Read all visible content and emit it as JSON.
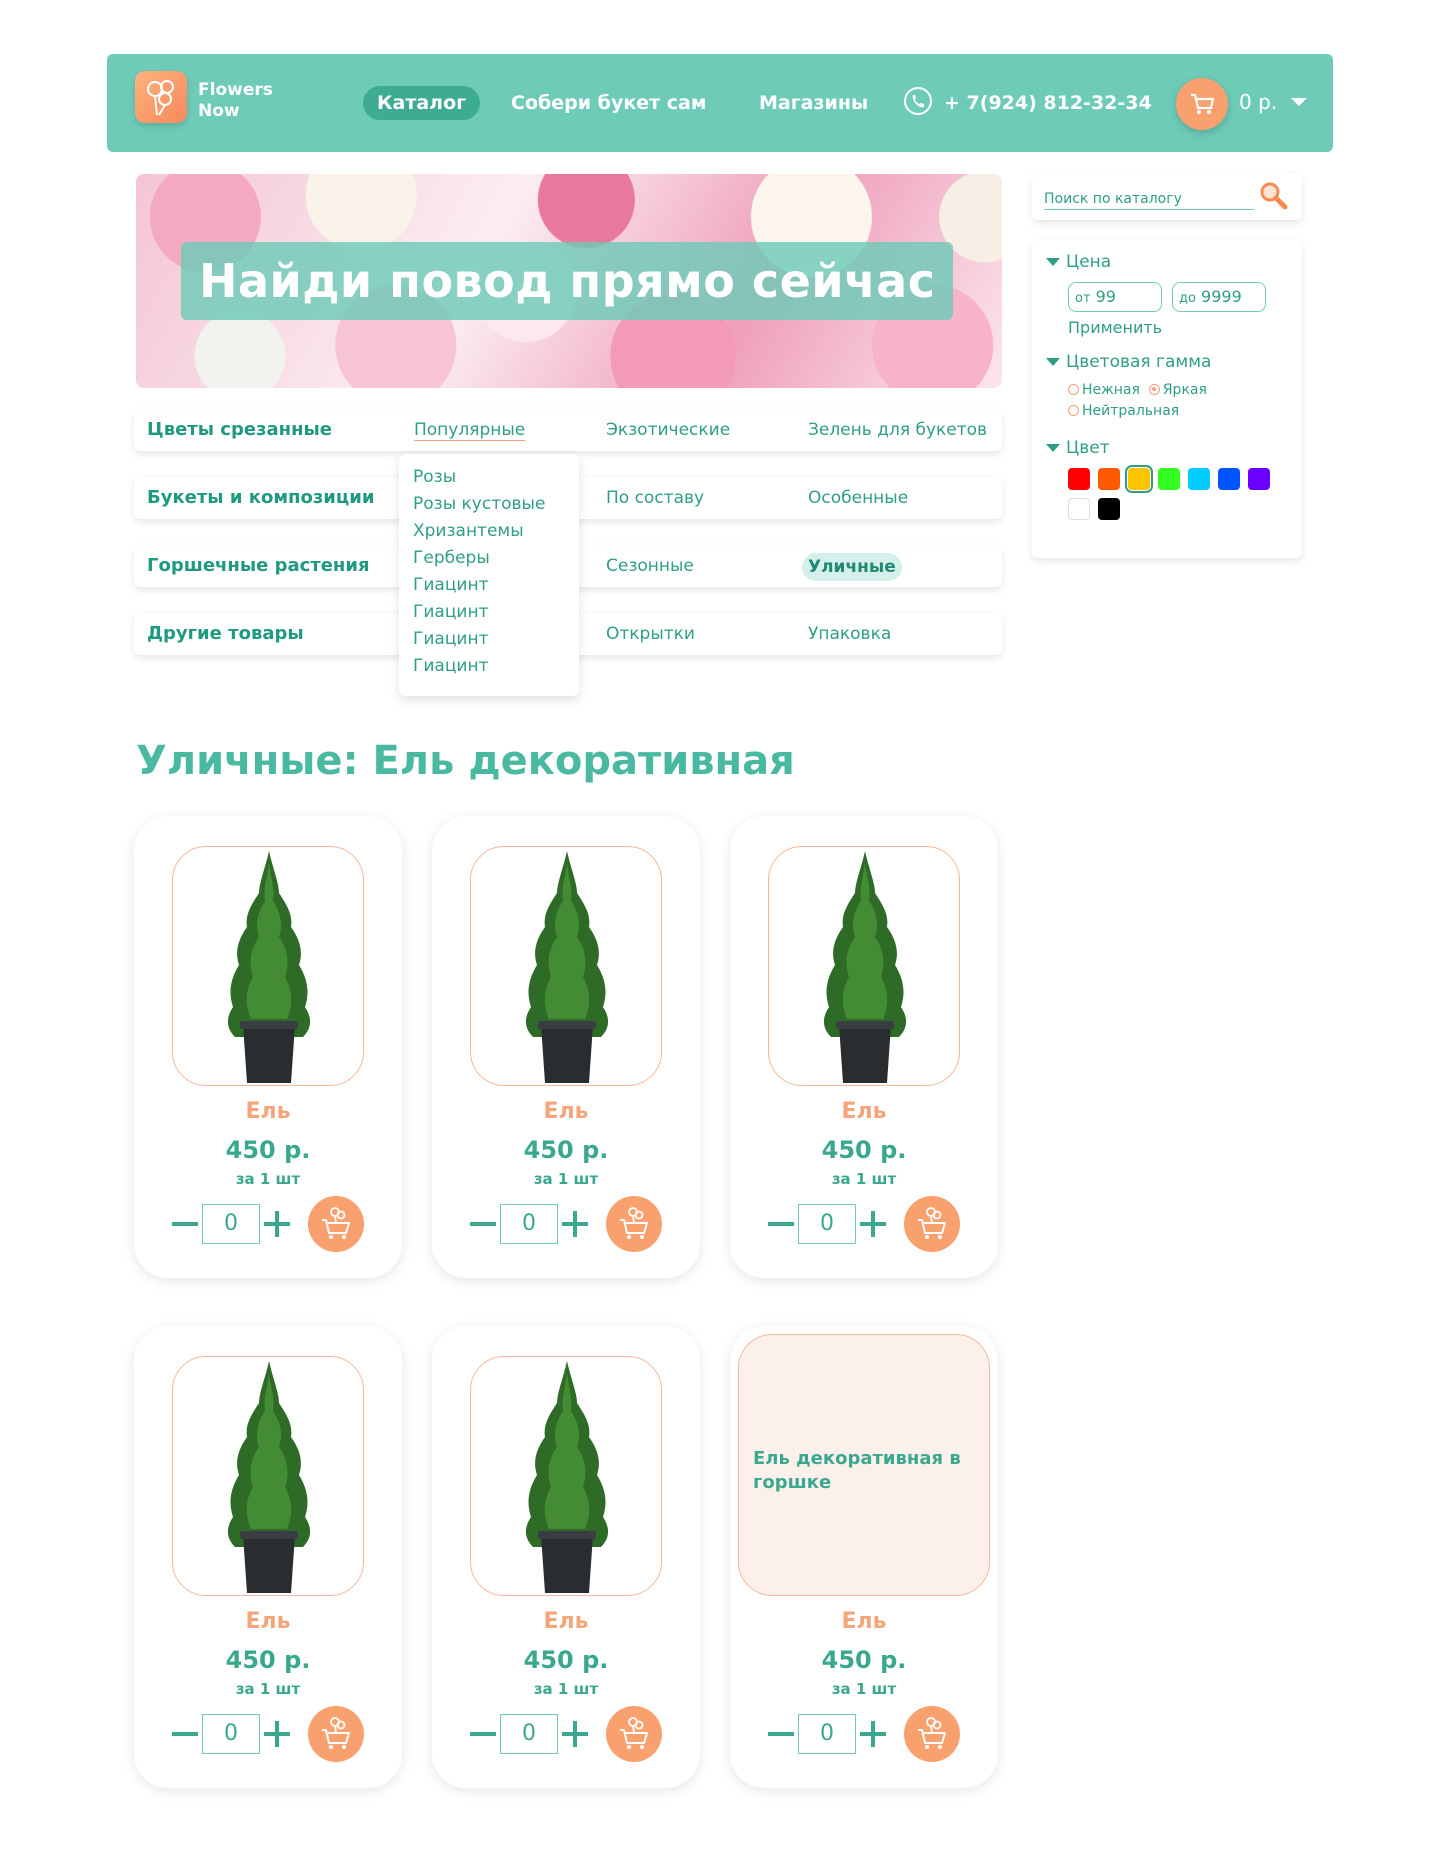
{
  "header": {
    "logo_line1": "Flowers",
    "logo_line2": "Now",
    "nav": {
      "catalog": "Каталог",
      "build": "Собери букет сам",
      "shops": "Магазины"
    },
    "phone": "+ 7(924) 812-32-34",
    "cart_total": "0 р."
  },
  "hero": {
    "title": "Найди повод прямо сейчас"
  },
  "categories": [
    {
      "name": "Цветы срезанные",
      "subs": [
        "Популярные",
        "Экзотические",
        "Зелень для букетов"
      ]
    },
    {
      "name": "Букеты и композиции",
      "subs": [
        "По составу",
        "Особенные"
      ]
    },
    {
      "name": "Горшечные растения",
      "subs": [
        "Сезонные",
        "Уличные"
      ]
    },
    {
      "name": "Другие товары",
      "subs": [
        "Открытки",
        "Упаковка"
      ]
    }
  ],
  "dropdown": [
    "Розы",
    "Розы кустовые",
    "Хризантемы",
    "Герберы",
    "Гиацинт",
    "Гиацинт",
    "Гиацинт",
    "Гиацинт"
  ],
  "search": {
    "placeholder": "Поиск по каталогу"
  },
  "filters": {
    "price_label": "Цена",
    "from_prefix": "от",
    "from_value": "99",
    "to_prefix": "до",
    "to_value": "9999",
    "apply": "Применить",
    "gamma_label": "Цветовая гамма",
    "gamma_options": [
      "Нежная",
      "Яркая",
      "Нейтральная"
    ],
    "gamma_selected": "Яркая",
    "color_label": "Цвет",
    "colors": [
      "#ff0000",
      "#ff5a00",
      "#ffc400",
      "#33ff22",
      "#00ccff",
      "#0055ff",
      "#6a00ff",
      "#ffffff",
      "#000000"
    ],
    "color_selected": "#ffc400"
  },
  "section_title": "Уличные: Ель декоративная",
  "products": [
    {
      "name": "Ель",
      "price": "450 р.",
      "unit": "за 1 шт",
      "qty": "0"
    },
    {
      "name": "Ель",
      "price": "450 р.",
      "unit": "за 1 шт",
      "qty": "0"
    },
    {
      "name": "Ель",
      "price": "450 р.",
      "unit": "за 1 шт",
      "qty": "0"
    },
    {
      "name": "Ель",
      "price": "450 р.",
      "unit": "за 1 шт",
      "qty": "0"
    },
    {
      "name": "Ель",
      "price": "450 р.",
      "unit": "за 1 шт",
      "qty": "0"
    },
    {
      "name": "Ель",
      "price": "450 р.",
      "unit": "за 1 шт",
      "qty": "0",
      "image_alt": "Ель декоративная в горшке"
    }
  ]
}
